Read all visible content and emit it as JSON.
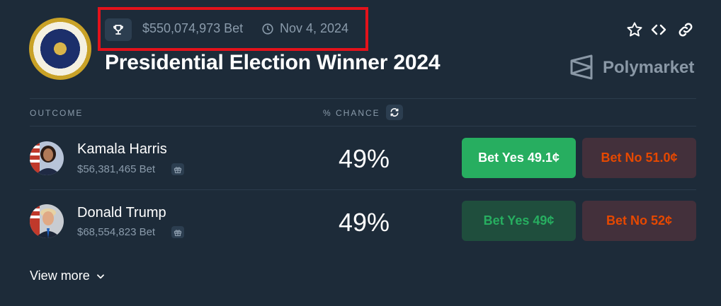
{
  "header": {
    "volume": "$550,074,973 Bet",
    "date": "Nov 4, 2024",
    "title": "Presidential Election Winner 2024",
    "brand": "Polymarket"
  },
  "table": {
    "outcome_header": "OUTCOME",
    "chance_header": "% CHANCE"
  },
  "outcomes": [
    {
      "name": "Kamala Harris",
      "volume": "$56,381,465 Bet",
      "chance": "49%",
      "yes_label": "Bet Yes 49.1¢",
      "no_label": "Bet No 51.0¢"
    },
    {
      "name": "Donald Trump",
      "volume": "$68,554,823 Bet",
      "chance": "49%",
      "yes_label": "Bet Yes 49¢",
      "no_label": "Bet No 52¢"
    }
  ],
  "footer": {
    "view_more": "View more"
  },
  "colors": {
    "background": "#1d2b39",
    "yes_green": "#27ae60",
    "no_orange": "#e64800",
    "highlight_red": "#e3121b"
  }
}
